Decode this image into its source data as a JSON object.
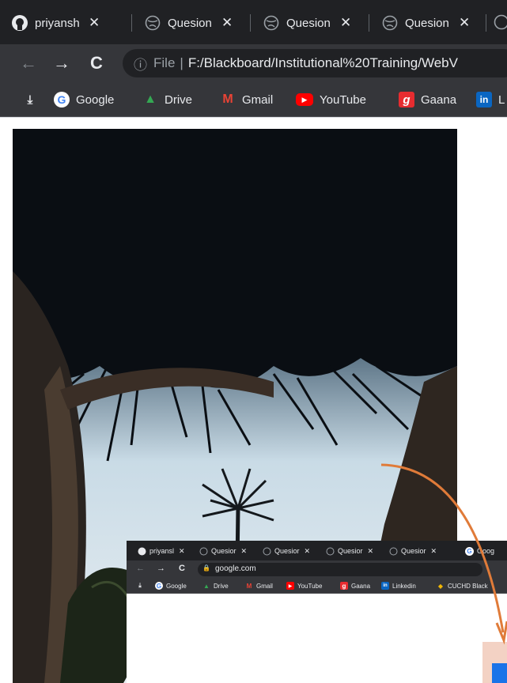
{
  "browser": {
    "tabs": [
      {
        "title": "priyansh",
        "icon": "github-icon"
      },
      {
        "title": "Quesion",
        "icon": "globe-icon"
      },
      {
        "title": "Quesion",
        "icon": "globe-icon"
      },
      {
        "title": "Quesion",
        "icon": "globe-icon"
      }
    ],
    "close_glyph": "✕",
    "toolbar": {
      "back": "←",
      "forward": "→",
      "reload": "C",
      "info": "ⓘ",
      "scheme_label": "File",
      "separator": "|",
      "url": "F:/Blackboard/Institutional%20Training/WebV"
    },
    "bookmarks": [
      {
        "label": "",
        "icon": "download-icon",
        "glyph": "⤓"
      },
      {
        "label": "Google",
        "icon": "google-icon",
        "glyph": "G",
        "color": "#4285f4"
      },
      {
        "label": "Drive",
        "icon": "drive-icon",
        "glyph": "▲",
        "color": "#fbbc04"
      },
      {
        "label": "Gmail",
        "icon": "gmail-icon",
        "glyph": "M",
        "color": "#ea4335"
      },
      {
        "label": "YouTube",
        "icon": "youtube-icon",
        "glyph": "▶",
        "color": "#ff0000"
      },
      {
        "label": "Gaana",
        "icon": "gaana-icon",
        "glyph": "g",
        "color": "#e72c30"
      },
      {
        "label": "L",
        "icon": "linkedin-icon",
        "glyph": "in",
        "color": "#0a66c2"
      }
    ]
  },
  "inner_browser": {
    "tabs": [
      {
        "title": "priyansl",
        "icon": "github-icon"
      },
      {
        "title": "Quesior",
        "icon": "globe-icon"
      },
      {
        "title": "Quesior",
        "icon": "globe-icon"
      },
      {
        "title": "Quesior",
        "icon": "globe-icon"
      },
      {
        "title": "Quesior",
        "icon": "globe-icon"
      },
      {
        "title": "Goog",
        "icon": "google-icon"
      }
    ],
    "close_glyph": "✕",
    "back": "←",
    "forward": "→",
    "reload": "C",
    "lock": "🔒",
    "url": "google.com",
    "bookmarks": [
      {
        "label": "",
        "icon": "download-icon",
        "glyph": "⤓"
      },
      {
        "label": "Google",
        "icon": "google-icon",
        "glyph": "G",
        "color": "#4285f4"
      },
      {
        "label": "Drive",
        "icon": "drive-icon",
        "glyph": "▲",
        "color": "#fbbc04"
      },
      {
        "label": "Gmail",
        "icon": "gmail-icon",
        "glyph": "M",
        "color": "#ea4335"
      },
      {
        "label": "YouTube",
        "icon": "youtube-icon",
        "glyph": "▶",
        "color": "#ff0000"
      },
      {
        "label": "Gaana",
        "icon": "gaana-icon",
        "glyph": "g",
        "color": "#e72c30"
      },
      {
        "label": "Linkedin",
        "icon": "linkedin-icon",
        "glyph": "in",
        "color": "#0a66c2"
      },
      {
        "label": "CUCHD Black",
        "icon": "blackboard-icon",
        "glyph": "◆",
        "color": "#f2b705"
      }
    ]
  },
  "colors": {
    "annotation_arrow": "#e07b39"
  }
}
